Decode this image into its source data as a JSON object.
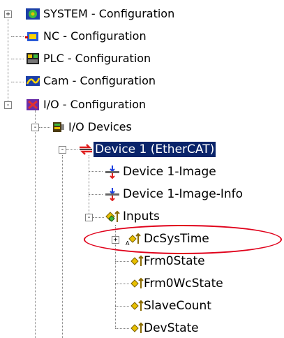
{
  "tree": {
    "system": {
      "label": "SYSTEM - Configuration",
      "expander": "+",
      "icon": "system-config-icon"
    },
    "nc": {
      "label": "NC - Configuration",
      "icon": "nc-config-icon"
    },
    "plc": {
      "label": "PLC - Configuration",
      "icon": "plc-config-icon"
    },
    "cam": {
      "label": "Cam - Configuration",
      "icon": "cam-config-icon"
    },
    "io": {
      "label": "I/O - Configuration",
      "expander": "-",
      "icon": "io-config-icon"
    },
    "io_devices": {
      "label": "I/O Devices",
      "expander": "-",
      "icon": "io-devices-icon"
    },
    "device1": {
      "label": "Device 1 (EtherCAT)",
      "expander": "-",
      "icon": "ethercat-device-icon",
      "selected": true
    },
    "image": {
      "label": "Device 1-Image",
      "icon": "process-image-icon"
    },
    "image_info": {
      "label": "Device 1-Image-Info",
      "icon": "process-image-icon"
    },
    "inputs": {
      "label": "Inputs",
      "expander": "-",
      "icon": "inputs-folder-icon"
    },
    "dcsystime": {
      "label": "DcSysTime",
      "expander": "+",
      "icon": "input-variable-icon"
    },
    "frm0state": {
      "label": "Frm0State",
      "icon": "input-variable-icon"
    },
    "frm0wcstate": {
      "label": "Frm0WcState",
      "icon": "input-variable-icon"
    },
    "slavecount": {
      "label": "SlaveCount",
      "icon": "input-variable-icon"
    },
    "devstate": {
      "label": "DevState",
      "icon": "input-variable-icon"
    }
  },
  "colors": {
    "selection": "#0a246a",
    "highlight_oval": "#e0001a"
  }
}
